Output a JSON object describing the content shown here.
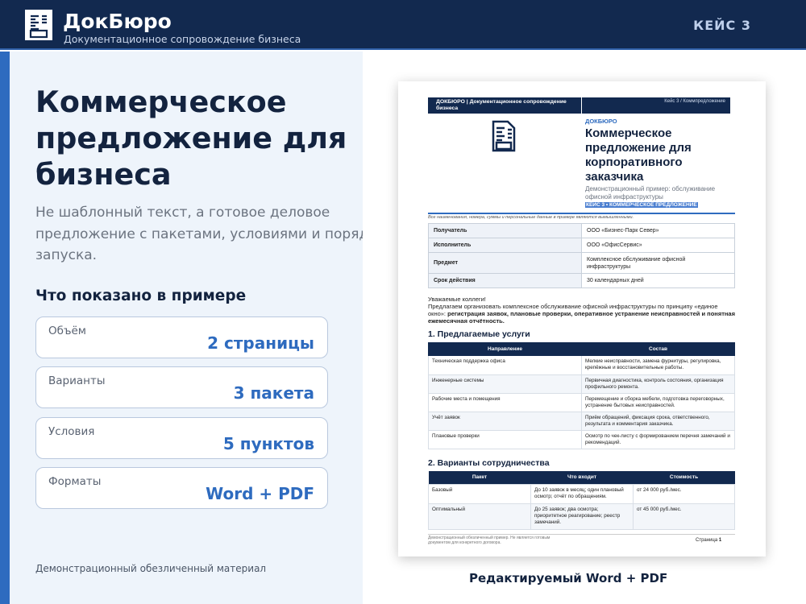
{
  "header": {
    "brand": "ДокБюро",
    "tagline": "Документационное сопровождение бизнеса",
    "case_label": "КЕЙС 3"
  },
  "hero": {
    "title": "Коммерческое предложение для бизнеса",
    "subtitle_lines": [
      "Не шаблонный текст, а готовое деловое",
      "предложение с пакетами, условиями и порядком",
      "запуска."
    ]
  },
  "shown": {
    "heading": "Что показано в примере",
    "items": [
      {
        "label": "Объём",
        "value": "2 страницы"
      },
      {
        "label": "Варианты",
        "value": "3 пакета"
      },
      {
        "label": "Условия",
        "value": "5 пунктов"
      },
      {
        "label": "Форматы",
        "value": "Word + PDF"
      }
    ]
  },
  "footer_note": "Демонстрационный обезличенный материал",
  "preview_caption": "Редактируемый Word + PDF",
  "doc": {
    "header_left": "ДОКБЮРО | Документационное сопровождение бизнеса",
    "header_right": "Кейс 3 / Коммпредложение",
    "brand": "ДОКБЮРО",
    "title": "Коммерческое предложение для корпоративного заказчика",
    "subtitle": "Демонстрационный пример: обслуживание офисной инфраструктуры",
    "badge": "КЕЙС 3 • КОММЕРЧЕСКОЕ ПРЕДЛОЖЕНИЕ",
    "note": "Все наименования, номера, суммы и персональные данные в примере являются вымышленными.",
    "meta": [
      {
        "k": "Получатель",
        "v": "ООО «Бизнес-Парк Север»"
      },
      {
        "k": "Исполнитель",
        "v": "ООО «ОфисСервис»"
      },
      {
        "k": "Предмет",
        "v": "Комплексное обслуживание офисной инфраструктуры"
      },
      {
        "k": "Срок действия",
        "v": "30 календарных дней"
      }
    ],
    "greeting": "Уважаемые коллеги!",
    "intro": "Предлагаем организовать комплексное обслуживание офисной инфраструктуры по принципу «единое окно»:",
    "intro_bold": "регистрация заявок, плановые проверки, оперативное устранение неисправностей и понятная ежемесячная отчётность.",
    "sec1": "1. Предлагаемые услуги",
    "services_head": [
      "Направление",
      "Состав"
    ],
    "services": [
      [
        "Техническая поддержка офиса",
        "Мелкие неисправности, замена фурнитуры, регулировка, крепёжные и восстановительные работы."
      ],
      [
        "Инженерные системы",
        "Первичная диагностика, контроль состояния, организация профильного ремонта."
      ],
      [
        "Рабочие места и помещения",
        "Перемещение и сборка мебели, подготовка переговорных, устранение бытовых неисправностей."
      ],
      [
        "Учёт заявок",
        "Приём обращений, фиксация срока, ответственного, результата и комментария заказчика."
      ],
      [
        "Плановые проверки",
        "Осмотр по чек-листу с формированием перечня замечаний и рекомендаций."
      ]
    ],
    "sec2": "2. Варианты сотрудничества",
    "packages_head": [
      "Пакет",
      "Что входит",
      "Стоимость"
    ],
    "packages": [
      [
        "Базовый",
        "До 10 заявок в месяц; один плановый осмотр; отчёт по обращениям.",
        "от 24 000 руб./мес."
      ],
      [
        "Оптимальный",
        "До 25 заявок; два осмотра; приоритетное реагирование; реестр замечаний.",
        "от 45 000 руб./мес."
      ]
    ],
    "footer": "Демонстрационный обезличенный пример. Не является готовым документом для конкретного договора.",
    "page_label": "Страница",
    "page_num": "1"
  }
}
